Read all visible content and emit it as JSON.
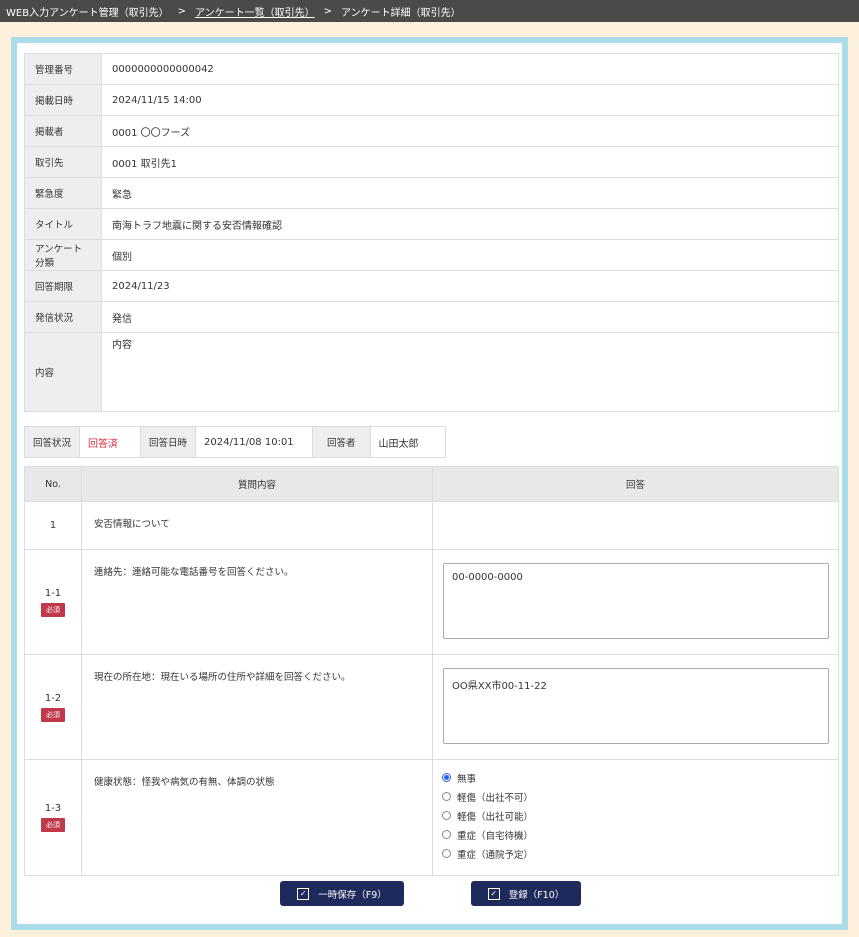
{
  "breadcrumb": {
    "item1": "WEB入力アンケート管理（取引先）",
    "sep": ">",
    "item2": "アンケート一覧（取引先）",
    "item3": "アンケート詳細（取引先）"
  },
  "info": [
    {
      "label": "管理番号",
      "value": "0000000000000042"
    },
    {
      "label": "掲載日時",
      "value": "2024/11/15 14:00"
    },
    {
      "label": "掲載者",
      "value": "0001 〇〇フーズ"
    },
    {
      "label": "取引先",
      "value": "0001 取引先1"
    },
    {
      "label": "緊急度",
      "value": "緊急"
    },
    {
      "label": "タイトル",
      "value": "南海トラフ地震に関する安否情報確認"
    },
    {
      "label": "アンケート分類",
      "value": "個別"
    },
    {
      "label": "回答期限",
      "value": "2024/11/23"
    },
    {
      "label": "発信状況",
      "value": "発信"
    },
    {
      "label": "内容",
      "value": "内容"
    }
  ],
  "status": {
    "status_label": "回答状況",
    "status_value": "回答済",
    "date_label": "回答日時",
    "date_value": "2024/11/08 10:01",
    "user_label": "回答者",
    "user_value": "山田太郎"
  },
  "questions": {
    "headers": {
      "no": "No.",
      "content": "質問内容",
      "answer": "回答"
    },
    "required": "必須",
    "rows": [
      {
        "no": "1",
        "text": "安否情報について"
      },
      {
        "no": "1-1",
        "text": "連絡先：連絡可能な電話番号を回答ください。",
        "answer": "00-0000-0000"
      },
      {
        "no": "1-2",
        "text": "現在の所在地：現在いる場所の住所や詳細を回答ください。",
        "answer": "OO県XX市00-11-22"
      },
      {
        "no": "1-3",
        "text": "健康状態：怪我や病気の有無、体調の状態",
        "options": [
          "無事",
          "軽傷（出社不可）",
          "軽傷（出社可能）",
          "重症（自宅待機）",
          "重症（通院予定）"
        ],
        "selected": "無事"
      }
    ]
  },
  "buttons": {
    "save": "一時保存（F9）",
    "register": "登録（F10）"
  },
  "colors": {
    "breadcrumb_bg": "#4a4a4a",
    "frame": "#aadcea",
    "page_bg": "#fdf0dc",
    "button": "#1e2a5c",
    "status_red": "#e0283a",
    "badge": "#c0394b"
  }
}
